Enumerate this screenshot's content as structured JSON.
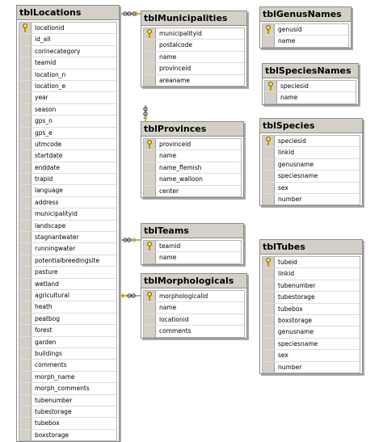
{
  "tables": {
    "tblLocations": {
      "title": "tblLocations",
      "columns": [
        {
          "name": "locationid",
          "pk": true
        },
        {
          "name": "id_all",
          "pk": false
        },
        {
          "name": "corinecategory",
          "pk": false
        },
        {
          "name": "teamid",
          "pk": false
        },
        {
          "name": "location_n",
          "pk": false
        },
        {
          "name": "location_e",
          "pk": false
        },
        {
          "name": "year",
          "pk": false
        },
        {
          "name": "season",
          "pk": false
        },
        {
          "name": "gps_n",
          "pk": false
        },
        {
          "name": "gps_e",
          "pk": false
        },
        {
          "name": "utmcode",
          "pk": false
        },
        {
          "name": "startdate",
          "pk": false
        },
        {
          "name": "enddate",
          "pk": false
        },
        {
          "name": "trapid",
          "pk": false
        },
        {
          "name": "language",
          "pk": false
        },
        {
          "name": "address",
          "pk": false
        },
        {
          "name": "municipalityid",
          "pk": false
        },
        {
          "name": "landscape",
          "pk": false
        },
        {
          "name": "stagnantwater",
          "pk": false
        },
        {
          "name": "runningwater",
          "pk": false
        },
        {
          "name": "potentialbreedingsite",
          "pk": false
        },
        {
          "name": "pasture",
          "pk": false
        },
        {
          "name": "wetland",
          "pk": false
        },
        {
          "name": "agricultural",
          "pk": false
        },
        {
          "name": "heath",
          "pk": false
        },
        {
          "name": "peatbog",
          "pk": false
        },
        {
          "name": "forest",
          "pk": false
        },
        {
          "name": "garden",
          "pk": false
        },
        {
          "name": "buildings",
          "pk": false
        },
        {
          "name": "comments",
          "pk": false
        },
        {
          "name": "morph_name",
          "pk": false
        },
        {
          "name": "morph_comments",
          "pk": false
        },
        {
          "name": "tubenumber",
          "pk": false
        },
        {
          "name": "tubestorage",
          "pk": false
        },
        {
          "name": "tubebox",
          "pk": false
        },
        {
          "name": "boxstorage",
          "pk": false
        }
      ]
    },
    "tblMunicipalities": {
      "title": "tblMunicipalities",
      "columns": [
        {
          "name": "municipalityid",
          "pk": true
        },
        {
          "name": "postalcode",
          "pk": false
        },
        {
          "name": "name",
          "pk": false
        },
        {
          "name": "provinceid",
          "pk": false
        },
        {
          "name": "areaname",
          "pk": false
        }
      ]
    },
    "tblProvinces": {
      "title": "tblProvinces",
      "columns": [
        {
          "name": "provinceid",
          "pk": true
        },
        {
          "name": "name",
          "pk": false
        },
        {
          "name": "name_flemish",
          "pk": false
        },
        {
          "name": "name_walloon",
          "pk": false
        },
        {
          "name": "center",
          "pk": false
        }
      ]
    },
    "tblTeams": {
      "title": "tblTeams",
      "columns": [
        {
          "name": "teamid",
          "pk": true
        },
        {
          "name": "name",
          "pk": false
        }
      ]
    },
    "tblMorphologicals": {
      "title": "tblMorphologicals",
      "columns": [
        {
          "name": "morphologicalid",
          "pk": true
        },
        {
          "name": "name",
          "pk": false
        },
        {
          "name": "locationid",
          "pk": false
        },
        {
          "name": "comments",
          "pk": false
        }
      ]
    },
    "tblGenusNames": {
      "title": "tblGenusNames",
      "columns": [
        {
          "name": "genusid",
          "pk": true
        },
        {
          "name": "name",
          "pk": false
        }
      ]
    },
    "tblSpeciesNames": {
      "title": "tblSpeciesNames",
      "columns": [
        {
          "name": "speciesid",
          "pk": true
        },
        {
          "name": "name",
          "pk": false
        }
      ]
    },
    "tblSpecies": {
      "title": "tblSpecies",
      "columns": [
        {
          "name": "speciesid",
          "pk": true
        },
        {
          "name": "linkid",
          "pk": false
        },
        {
          "name": "genusname",
          "pk": false
        },
        {
          "name": "speciesname",
          "pk": false
        },
        {
          "name": "sex",
          "pk": false
        },
        {
          "name": "number",
          "pk": false
        }
      ]
    },
    "tblTubes": {
      "title": "tblTubes",
      "columns": [
        {
          "name": "tubeid",
          "pk": true
        },
        {
          "name": "linkid",
          "pk": false
        },
        {
          "name": "tubenumber",
          "pk": false
        },
        {
          "name": "tubestorage",
          "pk": false
        },
        {
          "name": "tubebox",
          "pk": false
        },
        {
          "name": "boxstorage",
          "pk": false
        },
        {
          "name": "genusname",
          "pk": false
        },
        {
          "name": "speciesname",
          "pk": false
        },
        {
          "name": "sex",
          "pk": false
        },
        {
          "name": "number",
          "pk": false
        }
      ]
    }
  },
  "colors": {
    "title_bar": "#d4d0c8",
    "border": "#8c8c8c",
    "key": "#f2c200",
    "link_line": "#555555"
  }
}
